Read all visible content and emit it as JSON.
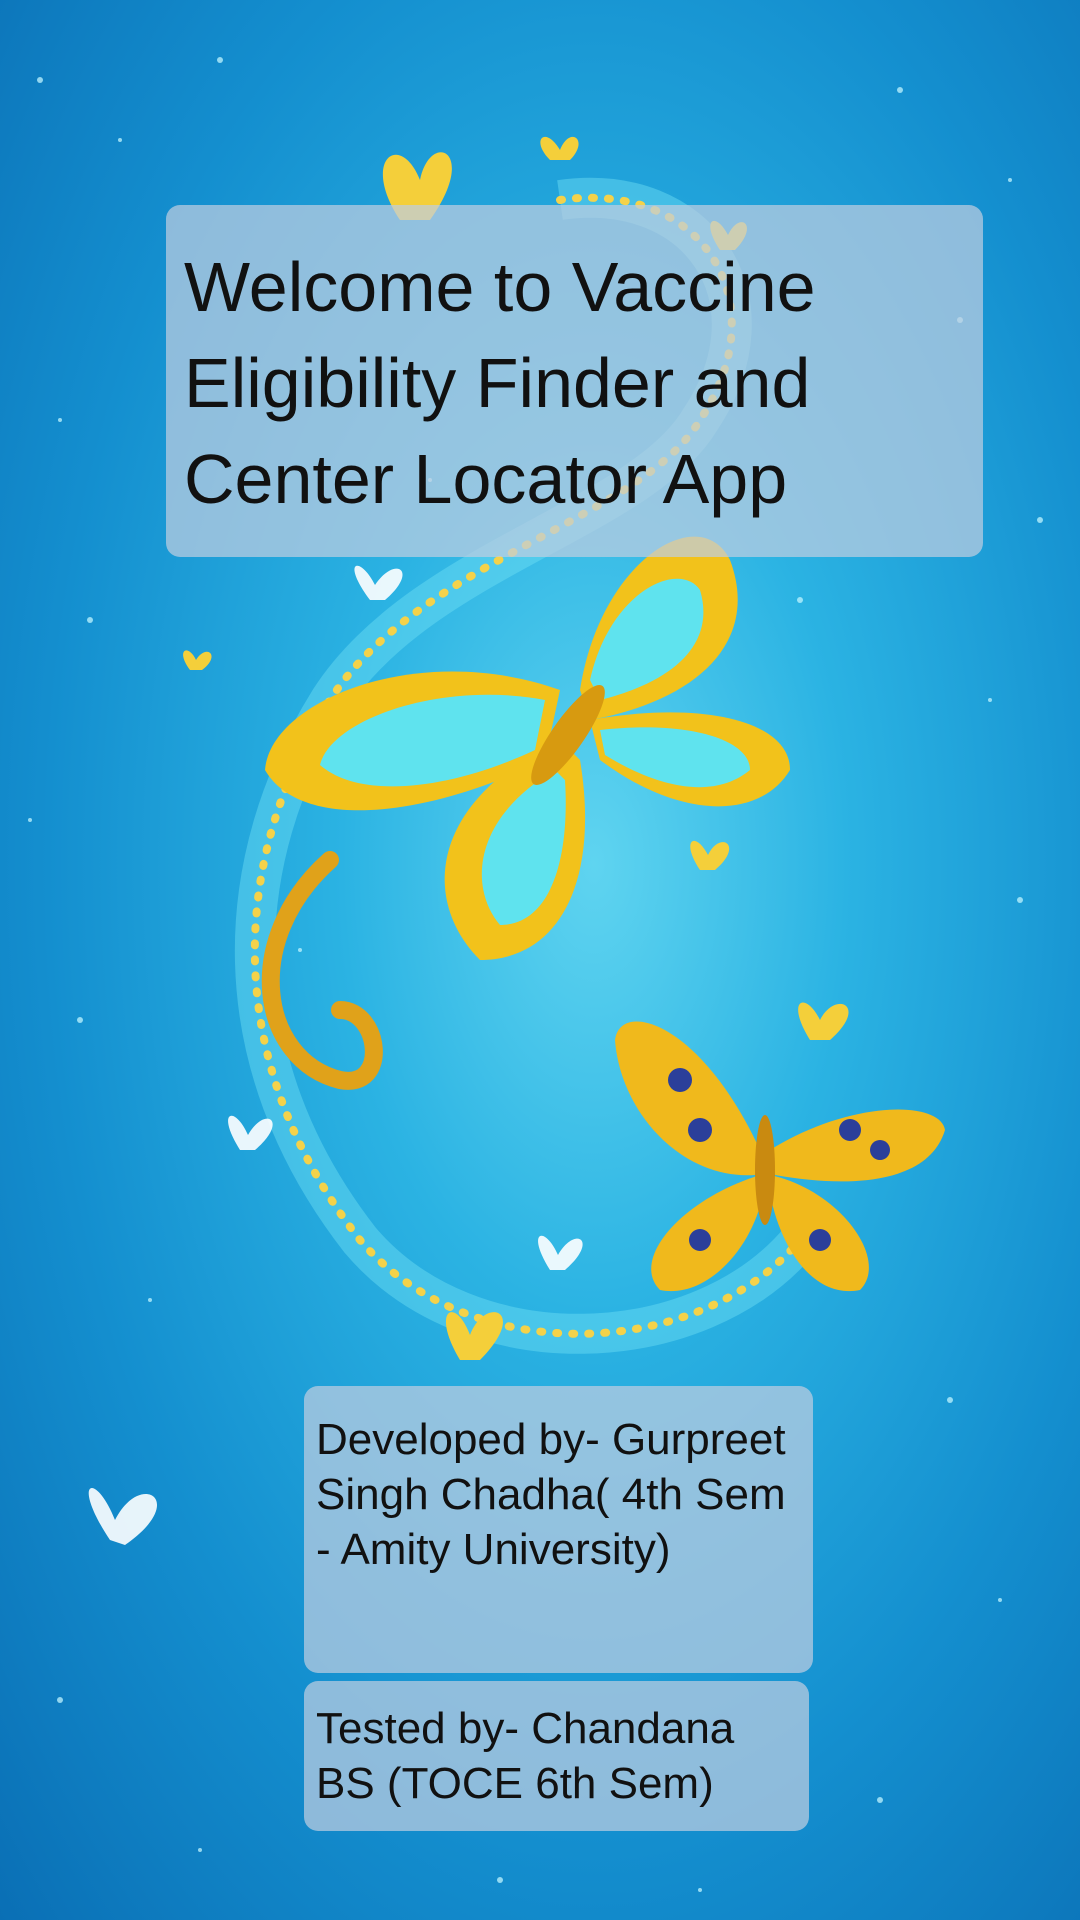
{
  "welcome": {
    "title": "Welcome to Vaccine Eligibility Finder and Center Locator App"
  },
  "credits": {
    "developer": "Developed by- Gurpreet Singh Chadha( 4th Sem - Amity University)",
    "tester": "Tested by- Chandana BS (TOCE 6th Sem)"
  },
  "colors": {
    "background": "#1aa3d6",
    "panel": "#becde1",
    "text": "#111111",
    "butterfly_gold": "#f2c21b",
    "butterfly_cyan": "#5fe3ee"
  },
  "background_art": "blue sparkle wallpaper with golden butterflies and swirl"
}
